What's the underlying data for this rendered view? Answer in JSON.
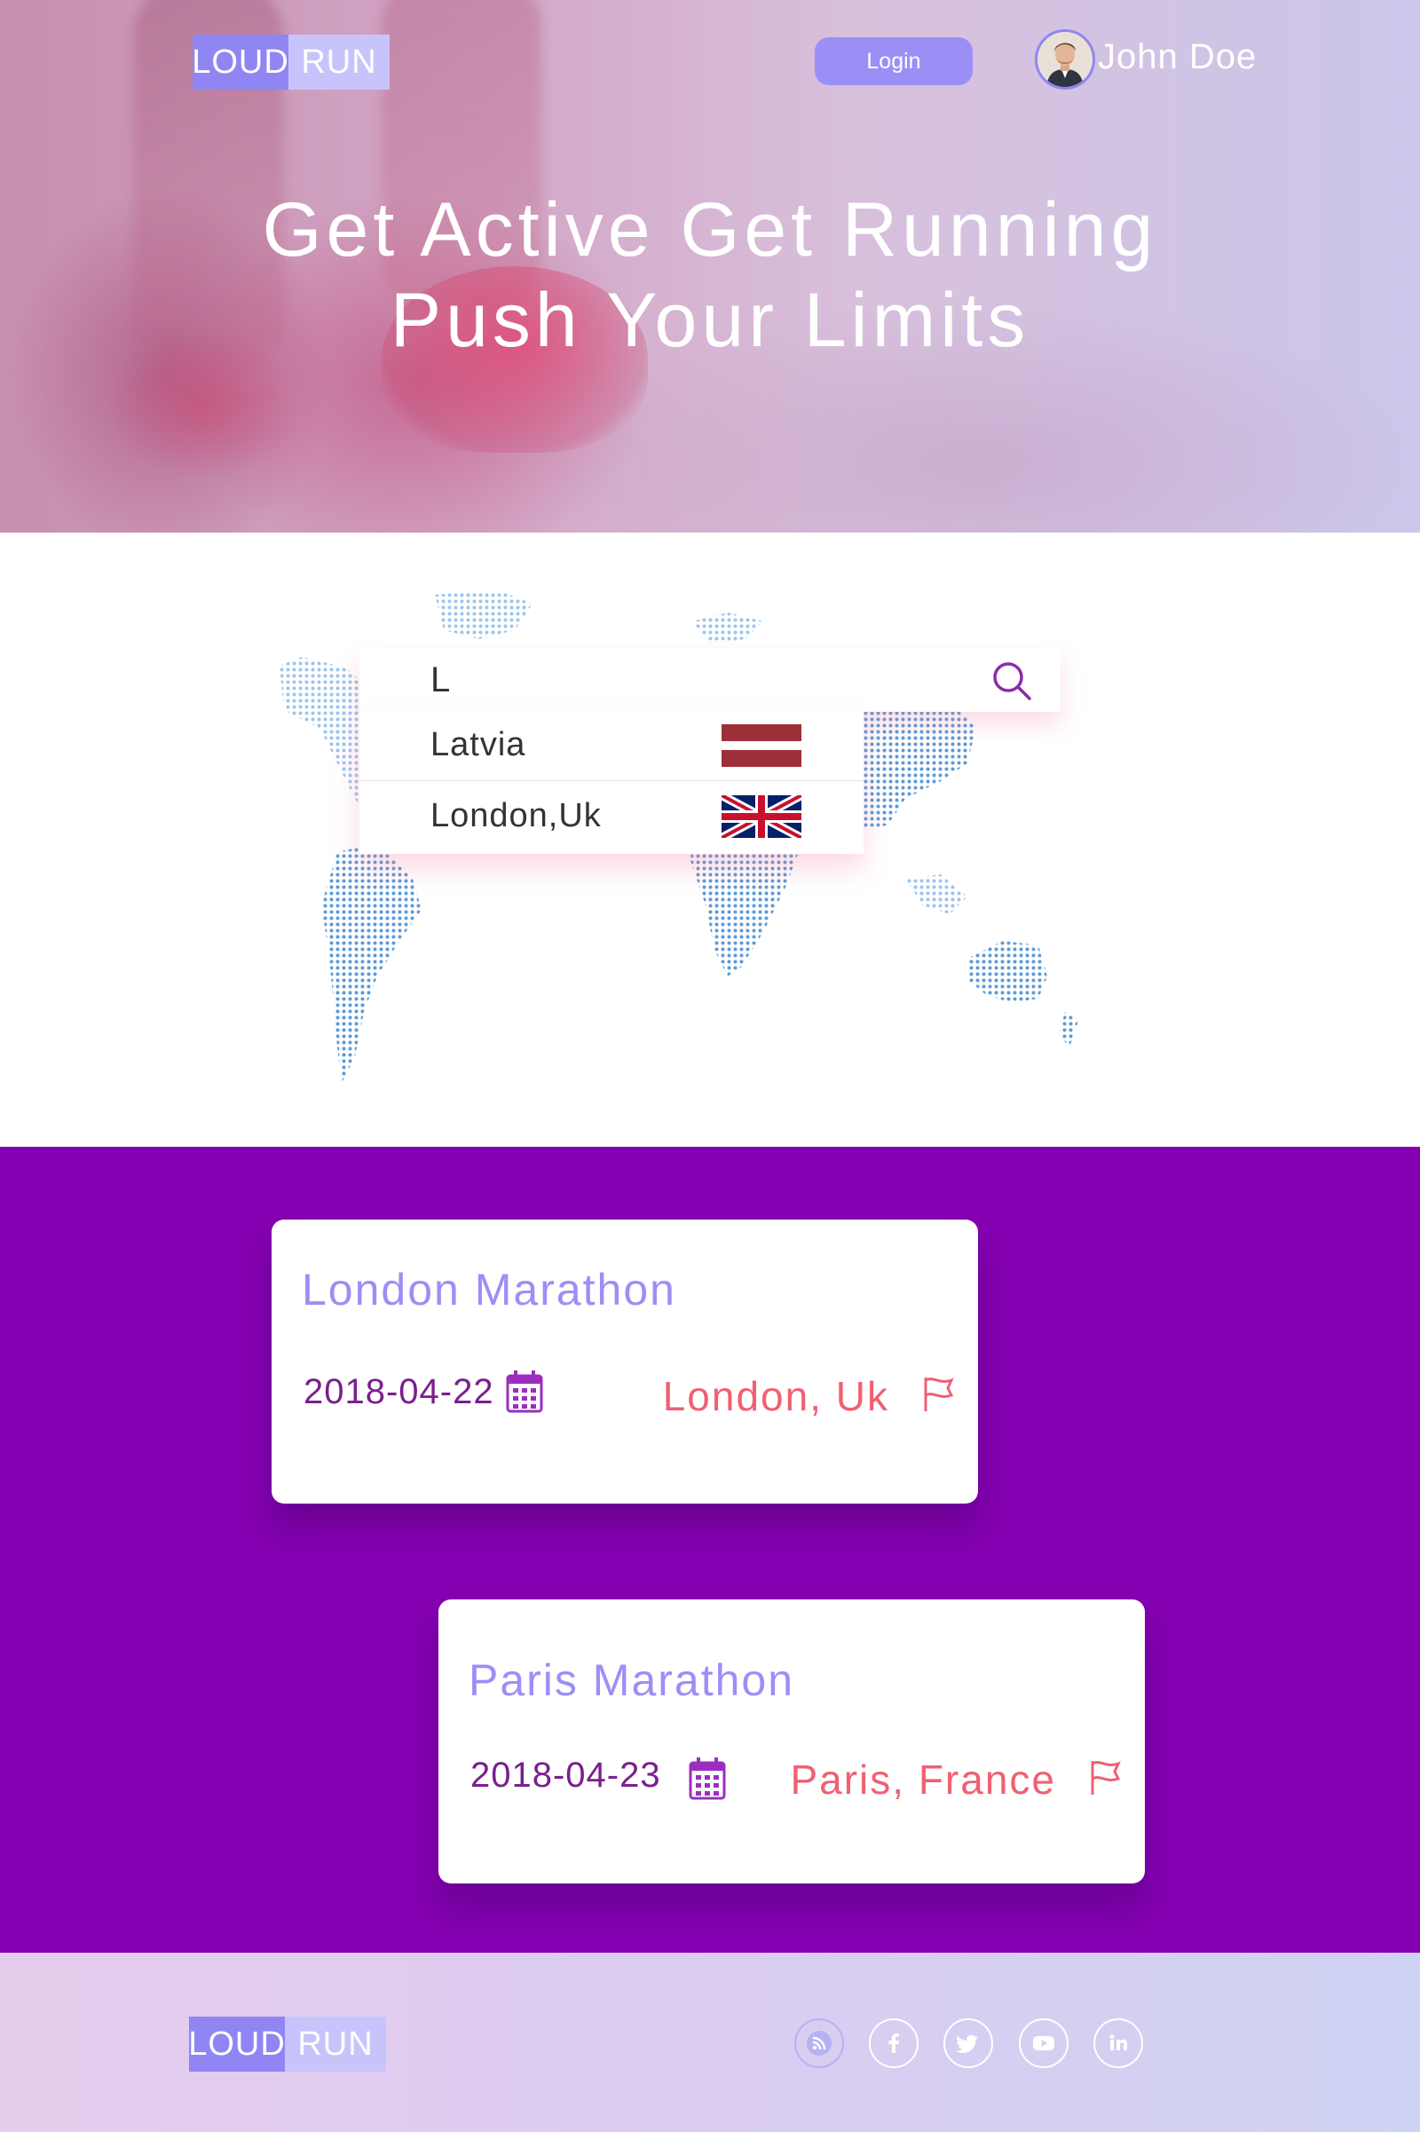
{
  "header": {
    "logo_left": "LOUD",
    "logo_right": "RUN",
    "login_label": "Login",
    "user_name": "John Doe"
  },
  "hero": {
    "title_line1": "Get Active Get Running",
    "title_line2": "Push Your Limits"
  },
  "search": {
    "value": "L",
    "suggestions": [
      {
        "label": "Latvia",
        "flag": "latvia-flag"
      },
      {
        "label": "London,Uk",
        "flag": "uk-flag"
      }
    ]
  },
  "events": [
    {
      "title": "London Marathon",
      "date": "2018-04-22",
      "location": "London, Uk"
    },
    {
      "title": "Paris Marathon",
      "date": "2018-04-23",
      "location": "Paris, France"
    }
  ],
  "footer": {
    "logo_left": "LOUD",
    "logo_right": "RUN",
    "social": [
      "rss-icon",
      "facebook-icon",
      "twitter-icon",
      "youtube-icon",
      "linkedin-icon"
    ]
  },
  "colors": {
    "accent": "#9b8ff6",
    "events_bg": "#8400b2",
    "location": "#f06073",
    "date": "#7a1f8d"
  }
}
